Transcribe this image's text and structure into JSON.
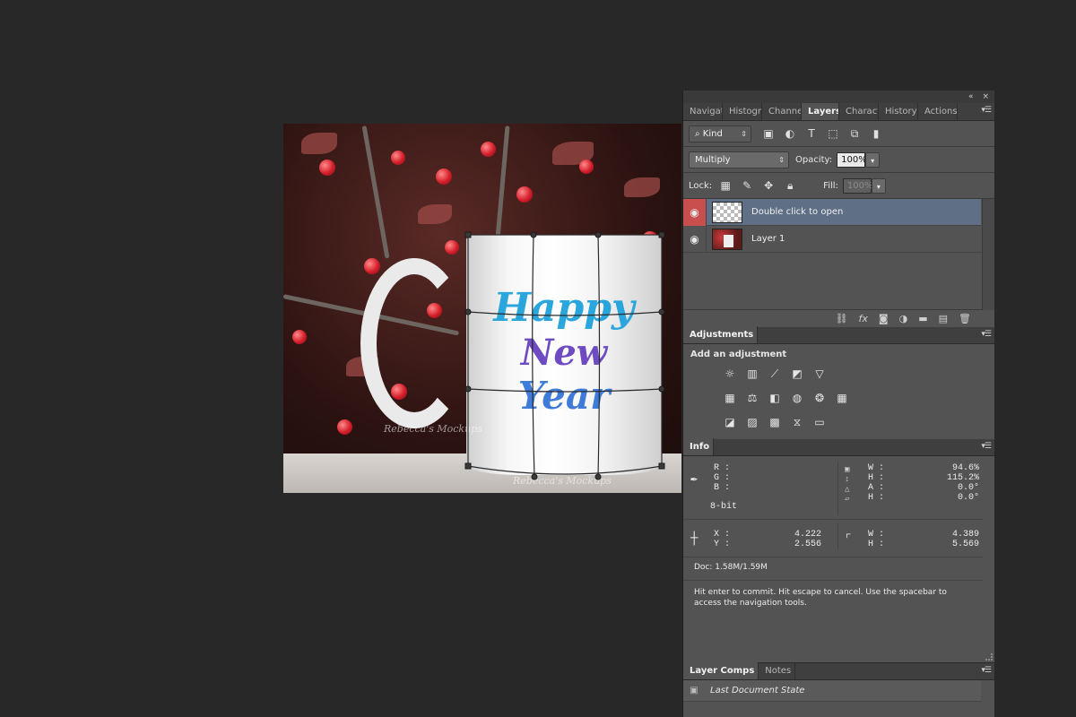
{
  "canvas": {
    "mug_text": {
      "line1": "Happy",
      "line2": "New",
      "line3": "Year"
    },
    "watermark": "Rebecca's Mockups"
  },
  "dock": {
    "collapse_icon": "double-chevron-left-icon",
    "close_icon": "close-icon",
    "collapse_glyph": "«",
    "close_glyph": "×"
  },
  "layers_panel": {
    "tabs": [
      "Navigat",
      "Histogr",
      "Channel",
      "Layers",
      "Charact",
      "History",
      "Actions"
    ],
    "active_tab": "Layers",
    "filter": {
      "label": "Kind"
    },
    "blend_mode": "Multiply",
    "opacity_label": "Opacity:",
    "opacity_value": "100%",
    "lock_label": "Lock:",
    "fill_label": "Fill:",
    "fill_value": "100%",
    "layers": [
      {
        "name": "Double click to open",
        "selected": true,
        "visible": true
      },
      {
        "name": "Layer 1",
        "selected": false,
        "visible": true
      }
    ]
  },
  "adjustments_panel": {
    "tab": "Adjustments",
    "heading": "Add an adjustment"
  },
  "info_panel": {
    "tab": "Info",
    "rgb": {
      "r_label": "R :",
      "g_label": "G :",
      "b_label": "B :"
    },
    "bit_depth": "8-bit",
    "transform": {
      "w_label": "W :",
      "w": "94.6%",
      "h_label": "H :",
      "h": "115.2%",
      "a_label": "A :",
      "a": "0.0°",
      "h2_label": "H :",
      "h2": "0.0°"
    },
    "position": {
      "x_label": "X :",
      "x": "4.222",
      "y_label": "Y :",
      "y": "2.556"
    },
    "size": {
      "w_label": "W :",
      "w": "4.389",
      "h_label": "H :",
      "h": "5.569"
    },
    "doc": "Doc: 1.58M/1.59M",
    "hint": "Hit enter to commit. Hit escape to cancel. Use the spacebar to access the navigation tools."
  },
  "layer_comps_panel": {
    "tabs": [
      "Layer Comps",
      "Notes"
    ],
    "active_tab": "Layer Comps",
    "items": [
      "Last Document State"
    ]
  },
  "colors": {
    "panel_bg": "#535353",
    "selected_layer": "#5e6f86",
    "eye_active": "#c94e4e",
    "canvas_bg": "#282828"
  }
}
